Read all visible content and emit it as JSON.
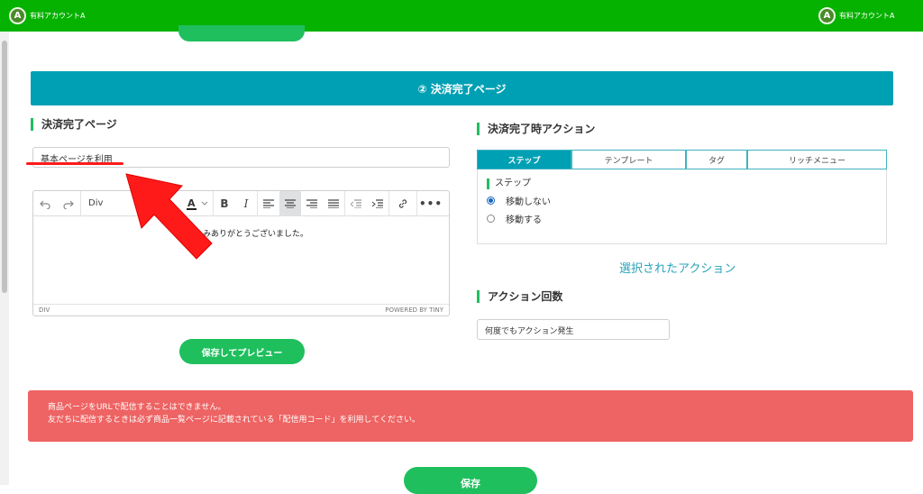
{
  "topbar": {
    "account_initial": "A",
    "account_name_left": "有料アカウントA",
    "account_name_right": "有料アカウントA",
    "color": "#06b200"
  },
  "section": {
    "title": "② 決済完了ページ",
    "color": "#00a0b4"
  },
  "left": {
    "page_label": "決済完了ページ",
    "page_select_value": "基本ページを利用",
    "editor": {
      "block_format": "Div",
      "content": "し込みありがとうございました。",
      "status_path": "DIV",
      "powered_by": "POWERED BY TINY",
      "toolbar_icons": [
        "undo-icon",
        "redo-icon",
        "text-color-icon",
        "bold-icon",
        "italic-icon",
        "align-left-icon",
        "align-center-icon",
        "align-right-icon",
        "align-justify-icon",
        "outdent-icon",
        "indent-icon",
        "link-icon",
        "more-icon"
      ]
    },
    "preview_button": "保存してプレビュー"
  },
  "right": {
    "action_label": "決済完了時アクション",
    "tabs": [
      "ステップ",
      "テンプレート",
      "タグ",
      "リッチメニュー"
    ],
    "active_tab": "ステップ",
    "step_label": "ステップ",
    "options": [
      {
        "label": "移動しない",
        "checked": true
      },
      {
        "label": "移動する",
        "checked": false
      }
    ],
    "selected_action_link": "選択されたアクション",
    "count_label": "アクション回数",
    "count_select_value": "何度でもアクション発生"
  },
  "alert": {
    "line1": "商品ページをURLで配信することはできません。",
    "line2": "友だちに配信するときは必ず商品一覧ページに記載されている「配信用コード」を利用してください。",
    "color": "#ee6363"
  },
  "save_button": "保存",
  "accent_green": "#1fbf5e"
}
